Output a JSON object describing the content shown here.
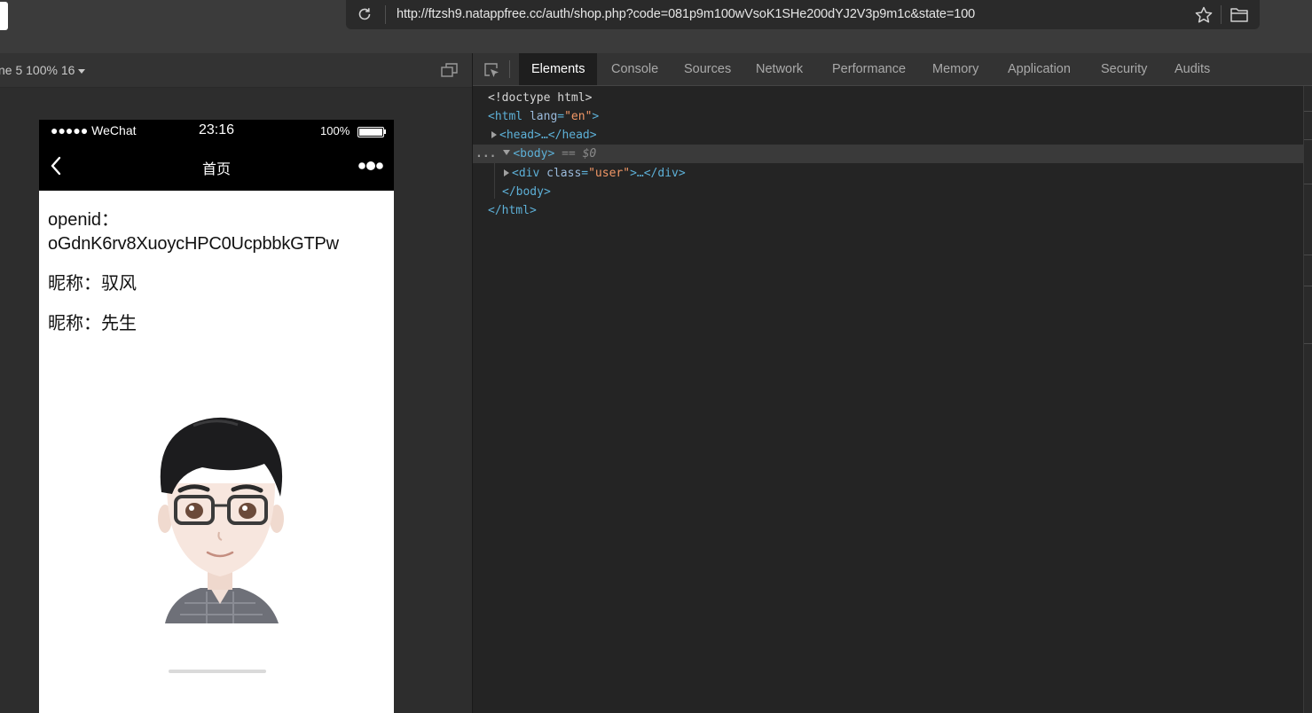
{
  "browser": {
    "url": "http://ftzsh9.natappfree.cc/auth/shop.php?code=081p9m100wVsoK1SHe200dYJ2V3p9m1c&state=100"
  },
  "emulator": {
    "device_label": "ne 5 100% 16"
  },
  "phone": {
    "carrier": "●●●●● WeChat",
    "time": "23:16",
    "battery": "100%",
    "battery_level": 1.0,
    "nav_title": "首页",
    "content": {
      "openid_label": "openid：",
      "openid_value": "oGdnK6rv8XuoycHPC0UcpbbkGTPw",
      "nickname_line": "昵称：驭风",
      "gender_line": "昵称：先生"
    }
  },
  "devtools": {
    "tabs": [
      "Elements",
      "Console",
      "Sources",
      "Network",
      "Performance",
      "Memory",
      "Application",
      "Security",
      "Audits"
    ],
    "active_tab": "Elements",
    "dom": {
      "doctype": "<!doctype html>",
      "html_open_tag": "<html",
      "html_attr": "lang",
      "html_attr_value": "\"en\"",
      "head": "<head>…</head>",
      "body_tag": "<body>",
      "body_marker": "== $0",
      "div_open": "<div",
      "div_attr": "class",
      "div_attr_value": "\"user\"",
      "div_rest": ">…</div>",
      "body_close": "</body>",
      "html_close": "</html>",
      "ellipsis": "..."
    }
  }
}
